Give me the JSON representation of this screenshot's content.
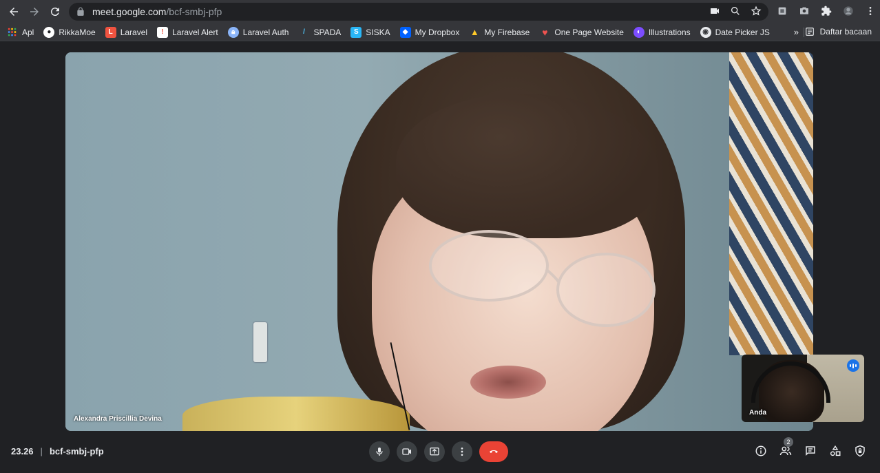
{
  "browser": {
    "url_host": "meet.google.com",
    "url_path": "/bcf-smbj-pfp",
    "bookmarks": [
      {
        "label": "Apl",
        "icon": "apps-grid-icon",
        "color": "#ea4335"
      },
      {
        "label": "RikkaMoe",
        "icon": "github-icon",
        "color": "#ffffff"
      },
      {
        "label": "Laravel",
        "icon": "laravel-icon",
        "color": "#f05340"
      },
      {
        "label": "Laravel Alert",
        "icon": "laravel-alert-icon",
        "color": "#f05340"
      },
      {
        "label": "Laravel Auth",
        "icon": "lock-icon",
        "color": "#8ab4f8"
      },
      {
        "label": "SPADA",
        "icon": "spada-icon",
        "color": "#4fc3f7"
      },
      {
        "label": "SISKA",
        "icon": "siska-icon",
        "color": "#29b6f6"
      },
      {
        "label": "My Dropbox",
        "icon": "dropbox-icon",
        "color": "#0061ff"
      },
      {
        "label": "My Firebase",
        "icon": "firebase-icon",
        "color": "#ffca28"
      },
      {
        "label": "One Page Website",
        "icon": "heart-icon",
        "color": "#ef5350"
      },
      {
        "label": "Illustrations",
        "icon": "illustrations-icon",
        "color": "#7c4dff"
      },
      {
        "label": "Date Picker JS",
        "icon": "globe-icon",
        "color": "#e8eaed"
      }
    ],
    "more_label": "»",
    "reading_list_label": "Daftar bacaan"
  },
  "meeting": {
    "main_speaker": "Alexandra Priscillia Devina",
    "self_label": "Anda",
    "time": "23.26",
    "separator": "|",
    "code": "bcf-smbj-pfp",
    "participant_count": "2"
  },
  "colors": {
    "end_call": "#ea4335",
    "audio_badge": "#1a73e8",
    "background": "#202124"
  }
}
